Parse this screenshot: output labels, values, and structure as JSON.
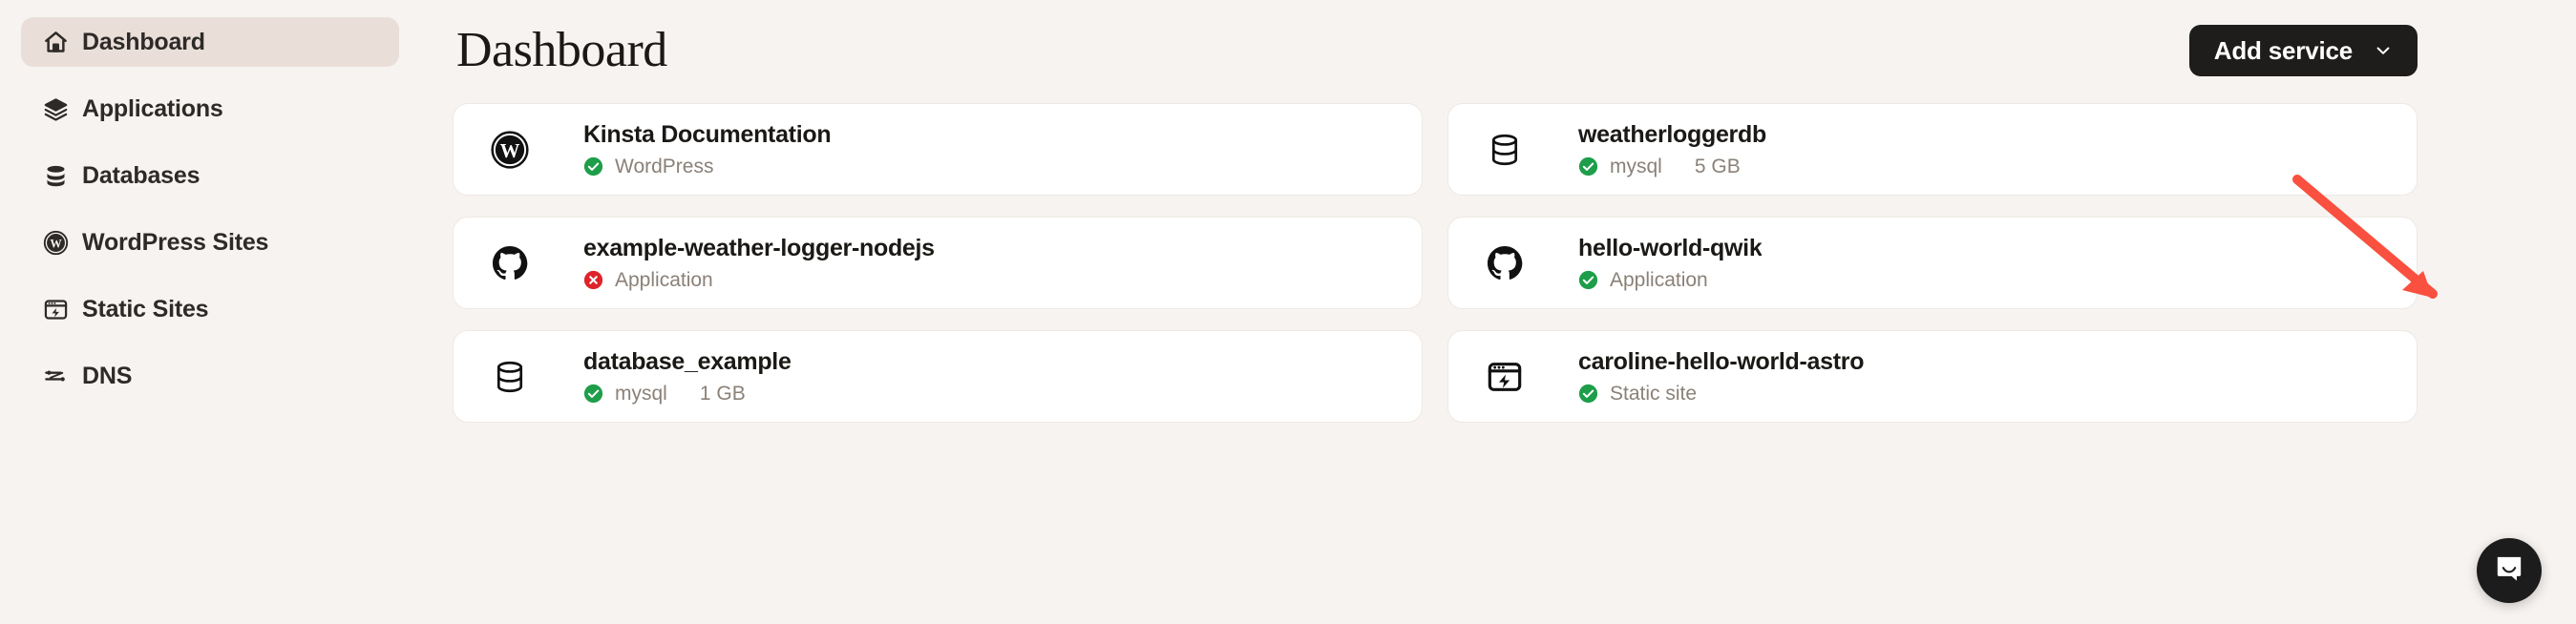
{
  "colors": {
    "page_background": "#F7F3F0",
    "sidebar_active_background": "#E9DFD8",
    "card_background": "#FFFFFF",
    "primary_button_background": "#1F1D1B",
    "status_ok": "#1E9E4A",
    "status_error": "#E0222B",
    "annotation_arrow": "#F9503F",
    "chat_launcher_background": "#1C1C1C",
    "text_primary": "#1B1916",
    "text_muted": "#8A8178"
  },
  "sidebar": {
    "items": [
      {
        "label": "Dashboard",
        "icon": "home-icon",
        "active": true
      },
      {
        "label": "Applications",
        "icon": "layers-icon",
        "active": false
      },
      {
        "label": "Databases",
        "icon": "database-icon",
        "active": false
      },
      {
        "label": "WordPress Sites",
        "icon": "wordpress-icon",
        "active": false
      },
      {
        "label": "Static Sites",
        "icon": "static-site-icon",
        "active": false
      },
      {
        "label": "DNS",
        "icon": "dns-icon",
        "active": false
      }
    ]
  },
  "header": {
    "title": "Dashboard",
    "add_service_label": "Add service",
    "add_service_icon": "chevron-down-icon"
  },
  "cards": [
    {
      "name": "Kinsta Documentation",
      "icon": "wordpress-icon",
      "status": "ok",
      "status_icon": "check-circle-icon",
      "type": "WordPress",
      "size": ""
    },
    {
      "name": "weatherloggerdb",
      "icon": "database-icon",
      "status": "ok",
      "status_icon": "check-circle-icon",
      "type": "mysql",
      "size": "5 GB"
    },
    {
      "name": "example-weather-logger-nodejs",
      "icon": "github-icon",
      "status": "error",
      "status_icon": "x-circle-icon",
      "type": "Application",
      "size": ""
    },
    {
      "name": "hello-world-qwik",
      "icon": "github-icon",
      "status": "ok",
      "status_icon": "check-circle-icon",
      "type": "Application",
      "size": ""
    },
    {
      "name": "database_example",
      "icon": "database-icon",
      "status": "ok",
      "status_icon": "check-circle-icon",
      "type": "mysql",
      "size": "1 GB"
    },
    {
      "name": "caroline-hello-world-astro",
      "icon": "static-site-icon",
      "status": "ok",
      "status_icon": "check-circle-icon",
      "type": "Static site",
      "size": ""
    }
  ],
  "chat": {
    "icon": "chat-bubble-icon"
  },
  "annotation": {
    "icon": "red-arrow-icon"
  }
}
